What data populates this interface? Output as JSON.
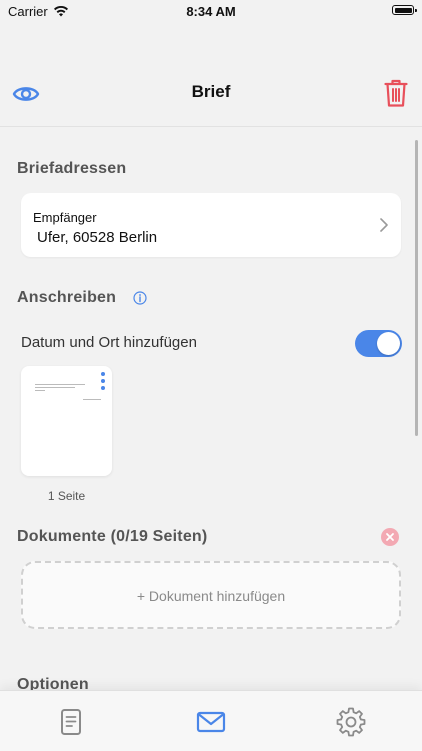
{
  "status": {
    "carrier": "Carrier",
    "time": "8:34 AM"
  },
  "nav": {
    "title": "Brief",
    "left_icon": "eye-icon",
    "right_icon": "trash-icon"
  },
  "addresses": {
    "title": "Briefadressen",
    "recipient_label": "Empfänger",
    "recipient_value": "Ufer, 60528 Berlin"
  },
  "cover_letter": {
    "title": "Anschreiben",
    "toggle_label": "Datum und Ort hinzufügen",
    "toggle_on": true,
    "page_count": "1 Seite"
  },
  "documents": {
    "title": "Dokumente (0/19 Seiten)",
    "add_label": "+ Dokument hinzufügen"
  },
  "options": {
    "title": "Optionen"
  },
  "tabs": [
    {
      "name": "documents-tab",
      "icon": "document-icon",
      "active": false
    },
    {
      "name": "letter-tab",
      "icon": "envelope-icon",
      "active": true
    },
    {
      "name": "settings-tab",
      "icon": "gear-icon",
      "active": false
    }
  ],
  "colors": {
    "accent": "#4a86e8",
    "danger": "#e8505b",
    "background": "#f2f2f2"
  }
}
